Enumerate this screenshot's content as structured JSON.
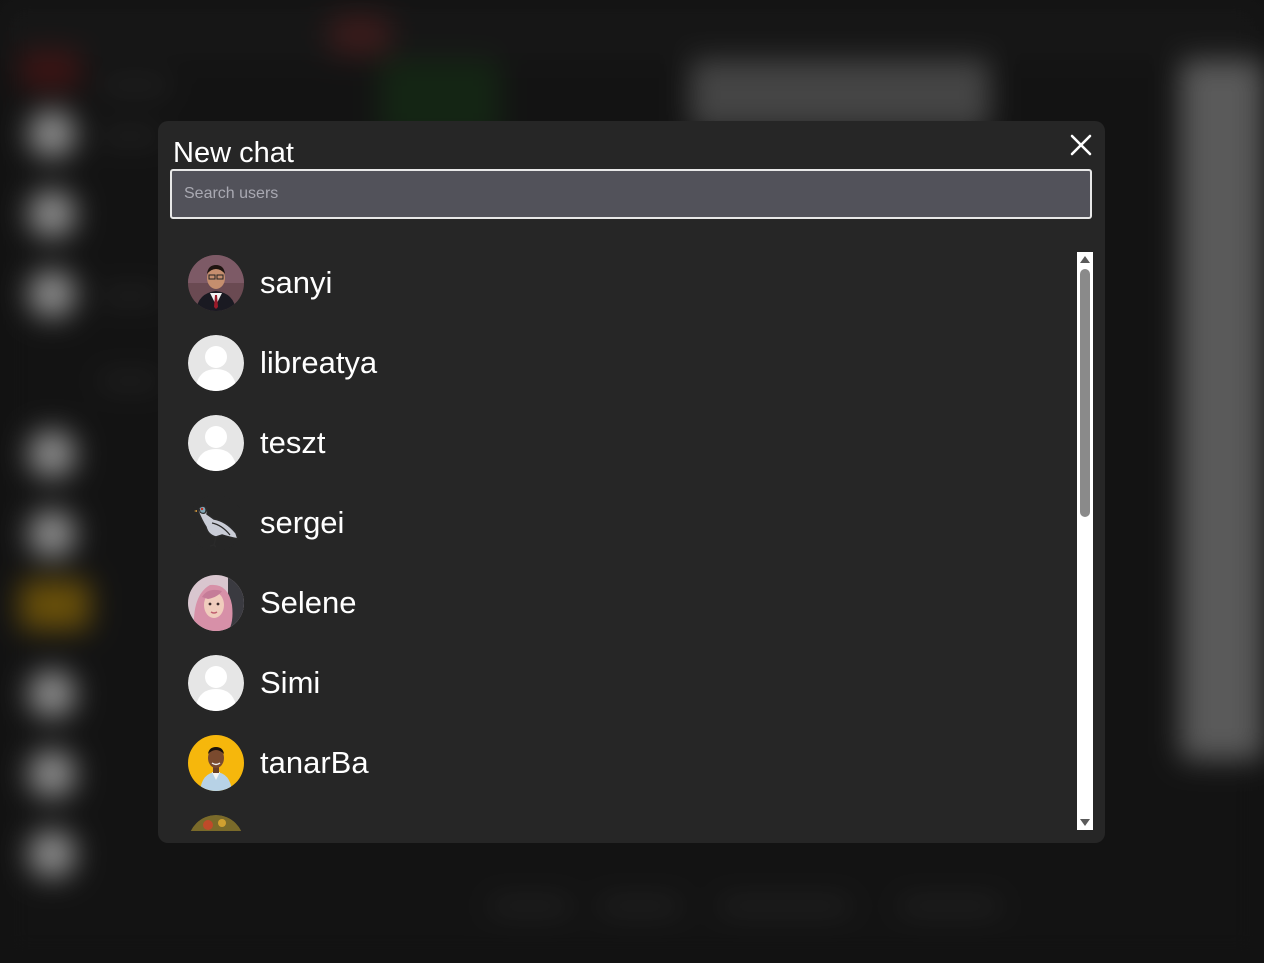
{
  "dialog": {
    "title": "New chat",
    "close_icon": "close-icon"
  },
  "search": {
    "placeholder": "Search users",
    "value": ""
  },
  "users": [
    {
      "name": "sanyi",
      "avatar": "photo-man-suit"
    },
    {
      "name": "libreatya",
      "avatar": "default-user-icon"
    },
    {
      "name": "teszt",
      "avatar": "default-user-icon"
    },
    {
      "name": "sergei",
      "avatar": "pigeon-icon"
    },
    {
      "name": "Selene",
      "avatar": "photo-woman-pink-hair"
    },
    {
      "name": "Simi",
      "avatar": "default-user-icon"
    },
    {
      "name": "tanarBa",
      "avatar": "photo-man-yellow-bg"
    },
    {
      "name": "",
      "avatar": "photo-partial"
    }
  ],
  "colors": {
    "modal_bg": "#262626",
    "input_bg": "#52525a",
    "text": "#ffffff"
  }
}
